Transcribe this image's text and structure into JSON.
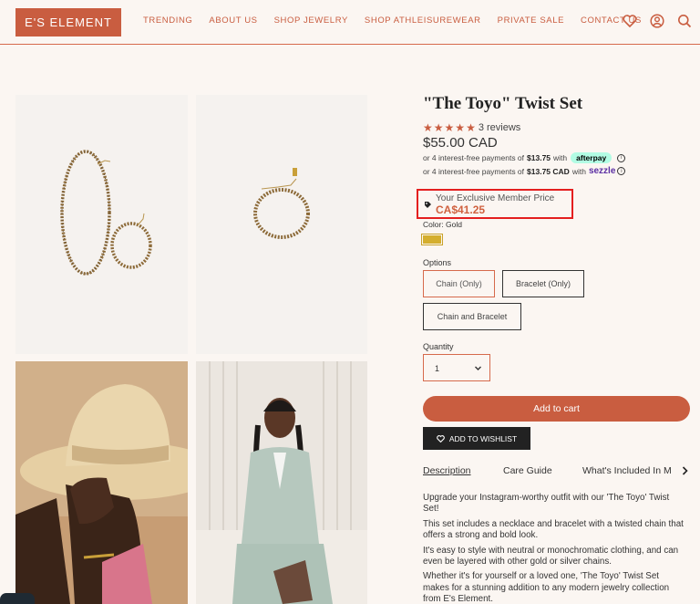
{
  "header": {
    "logo": "E'S ELEMENT",
    "nav": [
      "TRENDING",
      "ABOUT US",
      "SHOP JEWELRY",
      "SHOP ATHLEISUREWEAR",
      "PRIVATE SALE",
      "CONTACT US"
    ],
    "icons": [
      "heart-icon",
      "account-icon",
      "search-icon"
    ]
  },
  "product": {
    "title": "\"The Toyo\" Twist Set",
    "rating": 5,
    "reviews": "3 reviews",
    "price": "$55.00 CAD",
    "afterpay": {
      "prefix": "or 4 interest-free payments of",
      "amount": "$13.75",
      "suffix": "with",
      "brand": "afterpay"
    },
    "sezzle": {
      "prefix": "or 4 interest-free payments of",
      "amount": "$13.75 CAD",
      "suffix": "with",
      "brand": "sezzle"
    },
    "member": {
      "label": "Your Exclusive Member Price",
      "price": "CA$41.25"
    },
    "color": {
      "label": "Color: Gold",
      "swatch": "#d4ae2e"
    },
    "options": {
      "label": "Options",
      "items": [
        "Chain (Only)",
        "Bracelet (Only)",
        "Chain and Bracelet"
      ]
    },
    "quantity": {
      "label": "Quantity",
      "value": "1"
    },
    "add_to_cart": "Add to cart",
    "add_to_wishlist": "ADD TO WISHLIST",
    "tabs": [
      "Description",
      "Care Guide",
      "What's Included In M"
    ],
    "description": [
      "Upgrade your Instagram-worthy outfit with our 'The Toyo' Twist Set!",
      "This set includes a necklace and bracelet with a twisted chain that offers a strong and bold look.",
      "It's easy to style with neutral or monochromatic clothing, and can even be layered with other gold or silver chains.",
      "Whether it's for yourself or a loved one, 'The Toyo' Twist Set makes for a stunning addition to any modern jewelry collection from E's Element."
    ]
  },
  "colors": {
    "accent": "#c95d40",
    "background": "#fbf6f2",
    "highlight": "#e41f1f"
  }
}
